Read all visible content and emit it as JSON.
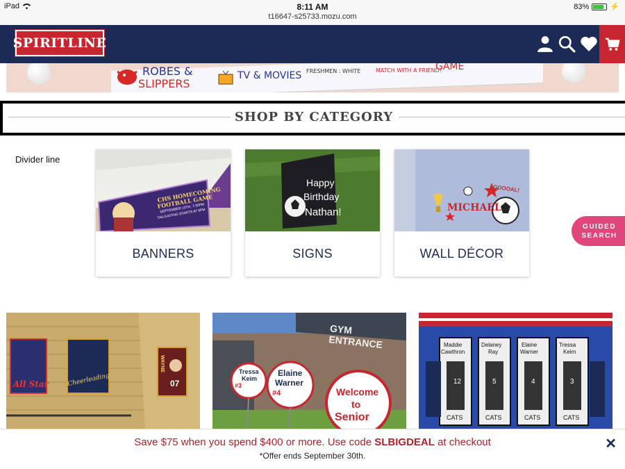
{
  "status_bar": {
    "device": "iPad",
    "time": "8:11 AM",
    "url": "t16647-s25733.mozu.com",
    "battery": "83%",
    "battery_level": 0.83
  },
  "header": {
    "logo_text": "SPIRITLINE",
    "icons": [
      "user-icon",
      "search-icon",
      "heart-icon",
      "cart-icon"
    ]
  },
  "hero": {
    "items": [
      "ROBES &",
      "SLIPPERS",
      "TV & MOVIES",
      "MATCH WITH A FRIEND!",
      "GAME",
      "FRESHMEN : WHITE"
    ]
  },
  "section": {
    "title": "SHOP BY CATEGORY",
    "divider_label": "Divider line"
  },
  "categories": [
    {
      "label": "BANNERS",
      "image_text": [
        "CHS HOMECOMING",
        "FOOTBALL GAME",
        "SEPTEMBER 10TH, 7:30PM",
        "TAILGAITING STARTS AT 6PM"
      ]
    },
    {
      "label": "SIGNS",
      "image_text": [
        "Happy",
        "Birthday",
        "Nathan!"
      ]
    },
    {
      "label": "WALL DÉCOR",
      "image_text": [
        "MICHAEL",
        "GOOOAL!"
      ]
    }
  ],
  "guided_search": {
    "line1": "GUIDED",
    "line2": "SEARCH"
  },
  "photos": [
    {
      "texts": [
        "All Star",
        "Cheerleading",
        "WAYNE",
        "07"
      ]
    },
    {
      "texts": [
        "GYM ENTRANCE",
        "Tressa",
        "Keim",
        "#3",
        "Elaine",
        "Warner",
        "#4",
        "Welcome",
        "to",
        "Senior"
      ]
    },
    {
      "texts": [
        "Maddie",
        "Cawthron",
        "Delaney",
        "Ray",
        "Elaine",
        "Warner",
        "Tressa",
        "Keim",
        "12",
        "5",
        "4",
        "3",
        "CATS",
        "CATS",
        "CATS",
        "CATS"
      ]
    }
  ],
  "promo": {
    "text_before": "Save $75 when you spend $400 or more. Use code ",
    "code": "SLBIGDEAL",
    "text_after": " at checkout",
    "sub": "*Offer ends September 30th.",
    "close": "✕"
  },
  "colors": {
    "navy": "#1b2b55",
    "red": "#c8262e",
    "pink": "#e0457b"
  }
}
